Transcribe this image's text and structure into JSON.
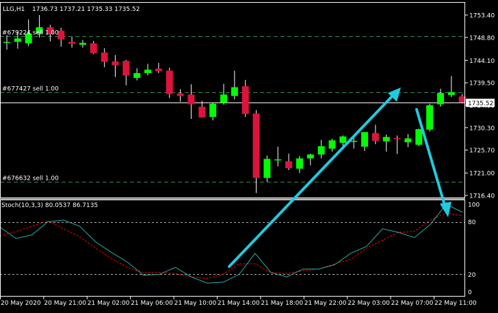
{
  "chart_title": "LLG,H1",
  "ohlc": "1736.73 1737.21 1735.33 1735.52",
  "current_price": "1735.52",
  "colors": {
    "background": "#000000",
    "bull": "#00ff00",
    "bear": "#dc143c",
    "wick": "#ffffff",
    "order_line": "#2e8b57",
    "arrow": "#1ecbe1",
    "stoch_main": "#20b2aa",
    "stoch_signal": "#ff0000",
    "text": "#ffffff",
    "frame": "#ffffff"
  },
  "orders": [
    {
      "label": "#679224 sell 1.00",
      "price": 1749.0
    },
    {
      "label": "#677427 sell 1.00",
      "price": 1737.6
    },
    {
      "label": "#676632 sell 1.00",
      "price": 1719.2
    }
  ],
  "indicator": {
    "label": "Stoch(10,3,3) 80.0537 86.7135",
    "levels": [
      80,
      20
    ],
    "axis_ticks": [
      "100",
      "80",
      "20",
      "0"
    ]
  },
  "chart_data": {
    "type": "candlestick",
    "price_ticks": [
      "1753.40",
      "1748.80",
      "1744.10",
      "1739.50",
      "1734.90",
      "1730.30",
      "1725.70",
      "1721.00",
      "1716.40"
    ],
    "price_tick_values": [
      1753.4,
      1748.8,
      1744.1,
      1739.5,
      1734.9,
      1730.3,
      1725.7,
      1721.0,
      1716.4
    ],
    "time_labels": [
      "20 May 2020",
      "20 May 21:00",
      "21 May 02:00",
      "21 May 06:00",
      "21 May 10:00",
      "21 May 14:00",
      "21 May 18:00",
      "21 May 22:00",
      "22 May 03:00",
      "22 May 07:00",
      "22 May 11:00"
    ],
    "candles": [
      {
        "o": 1747.7,
        "h": 1749.3,
        "l": 1746.3,
        "c": 1747.9
      },
      {
        "o": 1747.9,
        "h": 1750.0,
        "l": 1746.5,
        "c": 1748.6
      },
      {
        "o": 1747.6,
        "h": 1752.5,
        "l": 1747.0,
        "c": 1749.6
      },
      {
        "o": 1749.6,
        "h": 1753.4,
        "l": 1748.8,
        "c": 1750.9
      },
      {
        "o": 1750.9,
        "h": 1751.4,
        "l": 1748.0,
        "c": 1749.5
      },
      {
        "o": 1750.2,
        "h": 1750.8,
        "l": 1746.9,
        "c": 1748.4
      },
      {
        "o": 1747.9,
        "h": 1748.9,
        "l": 1746.7,
        "c": 1747.5
      },
      {
        "o": 1747.3,
        "h": 1748.3,
        "l": 1746.7,
        "c": 1747.7
      },
      {
        "o": 1747.6,
        "h": 1748.1,
        "l": 1745.4,
        "c": 1745.6
      },
      {
        "o": 1745.7,
        "h": 1746.6,
        "l": 1742.7,
        "c": 1743.8
      },
      {
        "o": 1743.9,
        "h": 1745.2,
        "l": 1740.7,
        "c": 1743.1
      },
      {
        "o": 1744.0,
        "h": 1744.2,
        "l": 1739.0,
        "c": 1741.0
      },
      {
        "o": 1740.5,
        "h": 1742.5,
        "l": 1740.0,
        "c": 1741.5
      },
      {
        "o": 1741.5,
        "h": 1743.4,
        "l": 1741.0,
        "c": 1742.2
      },
      {
        "o": 1742.4,
        "h": 1743.6,
        "l": 1741.5,
        "c": 1741.9
      },
      {
        "o": 1742.0,
        "h": 1742.6,
        "l": 1736.4,
        "c": 1737.2
      },
      {
        "o": 1737.3,
        "h": 1738.2,
        "l": 1735.6,
        "c": 1736.8
      },
      {
        "o": 1737.1,
        "h": 1739.2,
        "l": 1732.1,
        "c": 1735.1
      },
      {
        "o": 1734.6,
        "h": 1735.8,
        "l": 1732.4,
        "c": 1732.4
      },
      {
        "o": 1732.5,
        "h": 1735.4,
        "l": 1731.8,
        "c": 1735.2
      },
      {
        "o": 1735.4,
        "h": 1739.3,
        "l": 1735.0,
        "c": 1737.1
      },
      {
        "o": 1736.8,
        "h": 1742.0,
        "l": 1736.1,
        "c": 1738.6
      },
      {
        "o": 1738.8,
        "h": 1740.1,
        "l": 1732.5,
        "c": 1733.1
      },
      {
        "o": 1733.2,
        "h": 1733.9,
        "l": 1716.9,
        "c": 1720.0
      },
      {
        "o": 1720.0,
        "h": 1724.6,
        "l": 1719.2,
        "c": 1723.9
      },
      {
        "o": 1723.6,
        "h": 1726.4,
        "l": 1722.4,
        "c": 1723.8
      },
      {
        "o": 1723.4,
        "h": 1725.0,
        "l": 1721.6,
        "c": 1722.0
      },
      {
        "o": 1721.9,
        "h": 1724.5,
        "l": 1721.0,
        "c": 1724.0
      },
      {
        "o": 1724.0,
        "h": 1725.0,
        "l": 1722.6,
        "c": 1724.8
      },
      {
        "o": 1724.8,
        "h": 1727.8,
        "l": 1724.0,
        "c": 1726.5
      },
      {
        "o": 1726.0,
        "h": 1728.0,
        "l": 1725.4,
        "c": 1727.7
      },
      {
        "o": 1727.2,
        "h": 1728.7,
        "l": 1726.5,
        "c": 1728.5
      },
      {
        "o": 1727.6,
        "h": 1728.4,
        "l": 1726.0,
        "c": 1727.6
      },
      {
        "o": 1726.4,
        "h": 1729.4,
        "l": 1725.5,
        "c": 1729.4
      },
      {
        "o": 1729.2,
        "h": 1730.9,
        "l": 1726.9,
        "c": 1727.6
      },
      {
        "o": 1727.5,
        "h": 1728.9,
        "l": 1725.4,
        "c": 1728.4
      },
      {
        "o": 1728.2,
        "h": 1728.7,
        "l": 1724.9,
        "c": 1728.0
      },
      {
        "o": 1727.3,
        "h": 1729.0,
        "l": 1726.3,
        "c": 1728.1
      },
      {
        "o": 1726.8,
        "h": 1730.1,
        "l": 1726.5,
        "c": 1730.0
      },
      {
        "o": 1729.9,
        "h": 1735.2,
        "l": 1729.5,
        "c": 1734.9
      },
      {
        "o": 1735.1,
        "h": 1738.3,
        "l": 1734.6,
        "c": 1737.4
      },
      {
        "o": 1737.0,
        "h": 1740.9,
        "l": 1736.6,
        "c": 1737.6
      },
      {
        "o": 1736.7,
        "h": 1737.2,
        "l": 1735.3,
        "c": 1735.5
      }
    ],
    "stoch_main": [
      74,
      61,
      65,
      80,
      82,
      75,
      57,
      45,
      34,
      19,
      20,
      28,
      17,
      10,
      11,
      20,
      44,
      22,
      17,
      26,
      26,
      31,
      44,
      52,
      72,
      68,
      62,
      77,
      100,
      91
    ],
    "stoch_signal": [
      64,
      69,
      75,
      81,
      72,
      63,
      50,
      38,
      28,
      22,
      22,
      21,
      17,
      15,
      20,
      32,
      32,
      22,
      21,
      24,
      26,
      32,
      37,
      50,
      59,
      68,
      69,
      82,
      90,
      87
    ],
    "stoch_x_start": 0,
    "stoch_x_end": 42,
    "ylim": [
      1715.6,
      1755.2
    ]
  }
}
